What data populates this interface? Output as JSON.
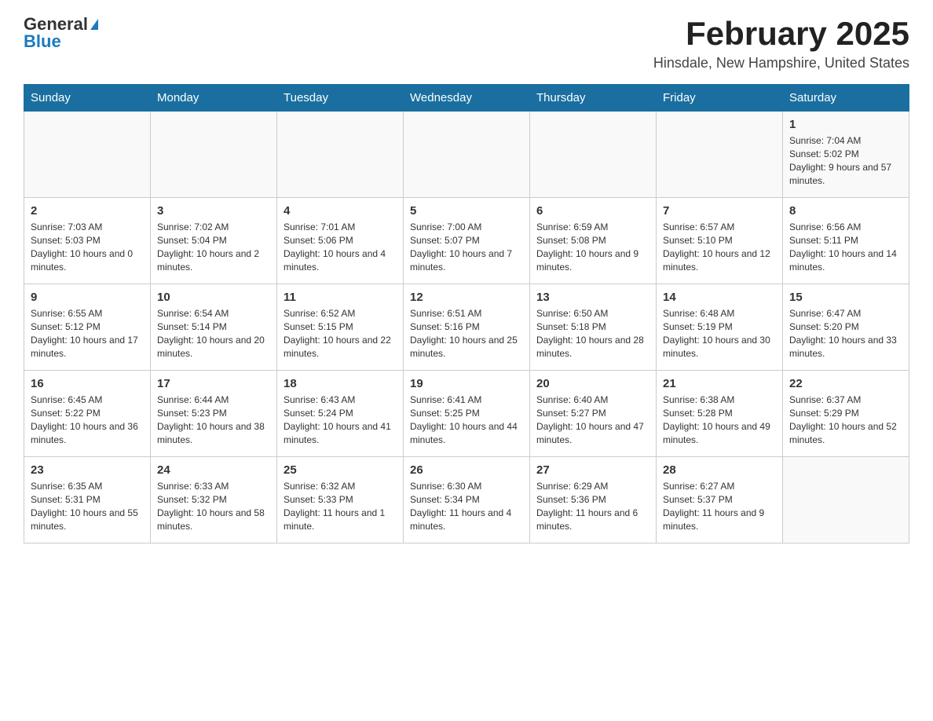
{
  "logo": {
    "text_general": "General",
    "text_blue": "Blue",
    "arrow_label": "general-blue-arrow"
  },
  "title": {
    "month": "February 2025",
    "location": "Hinsdale, New Hampshire, United States"
  },
  "days_of_week": [
    "Sunday",
    "Monday",
    "Tuesday",
    "Wednesday",
    "Thursday",
    "Friday",
    "Saturday"
  ],
  "weeks": [
    [
      {
        "date": "",
        "info": ""
      },
      {
        "date": "",
        "info": ""
      },
      {
        "date": "",
        "info": ""
      },
      {
        "date": "",
        "info": ""
      },
      {
        "date": "",
        "info": ""
      },
      {
        "date": "",
        "info": ""
      },
      {
        "date": "1",
        "info": "Sunrise: 7:04 AM\nSunset: 5:02 PM\nDaylight: 9 hours and 57 minutes."
      }
    ],
    [
      {
        "date": "2",
        "info": "Sunrise: 7:03 AM\nSunset: 5:03 PM\nDaylight: 10 hours and 0 minutes."
      },
      {
        "date": "3",
        "info": "Sunrise: 7:02 AM\nSunset: 5:04 PM\nDaylight: 10 hours and 2 minutes."
      },
      {
        "date": "4",
        "info": "Sunrise: 7:01 AM\nSunset: 5:06 PM\nDaylight: 10 hours and 4 minutes."
      },
      {
        "date": "5",
        "info": "Sunrise: 7:00 AM\nSunset: 5:07 PM\nDaylight: 10 hours and 7 minutes."
      },
      {
        "date": "6",
        "info": "Sunrise: 6:59 AM\nSunset: 5:08 PM\nDaylight: 10 hours and 9 minutes."
      },
      {
        "date": "7",
        "info": "Sunrise: 6:57 AM\nSunset: 5:10 PM\nDaylight: 10 hours and 12 minutes."
      },
      {
        "date": "8",
        "info": "Sunrise: 6:56 AM\nSunset: 5:11 PM\nDaylight: 10 hours and 14 minutes."
      }
    ],
    [
      {
        "date": "9",
        "info": "Sunrise: 6:55 AM\nSunset: 5:12 PM\nDaylight: 10 hours and 17 minutes."
      },
      {
        "date": "10",
        "info": "Sunrise: 6:54 AM\nSunset: 5:14 PM\nDaylight: 10 hours and 20 minutes."
      },
      {
        "date": "11",
        "info": "Sunrise: 6:52 AM\nSunset: 5:15 PM\nDaylight: 10 hours and 22 minutes."
      },
      {
        "date": "12",
        "info": "Sunrise: 6:51 AM\nSunset: 5:16 PM\nDaylight: 10 hours and 25 minutes."
      },
      {
        "date": "13",
        "info": "Sunrise: 6:50 AM\nSunset: 5:18 PM\nDaylight: 10 hours and 28 minutes."
      },
      {
        "date": "14",
        "info": "Sunrise: 6:48 AM\nSunset: 5:19 PM\nDaylight: 10 hours and 30 minutes."
      },
      {
        "date": "15",
        "info": "Sunrise: 6:47 AM\nSunset: 5:20 PM\nDaylight: 10 hours and 33 minutes."
      }
    ],
    [
      {
        "date": "16",
        "info": "Sunrise: 6:45 AM\nSunset: 5:22 PM\nDaylight: 10 hours and 36 minutes."
      },
      {
        "date": "17",
        "info": "Sunrise: 6:44 AM\nSunset: 5:23 PM\nDaylight: 10 hours and 38 minutes."
      },
      {
        "date": "18",
        "info": "Sunrise: 6:43 AM\nSunset: 5:24 PM\nDaylight: 10 hours and 41 minutes."
      },
      {
        "date": "19",
        "info": "Sunrise: 6:41 AM\nSunset: 5:25 PM\nDaylight: 10 hours and 44 minutes."
      },
      {
        "date": "20",
        "info": "Sunrise: 6:40 AM\nSunset: 5:27 PM\nDaylight: 10 hours and 47 minutes."
      },
      {
        "date": "21",
        "info": "Sunrise: 6:38 AM\nSunset: 5:28 PM\nDaylight: 10 hours and 49 minutes."
      },
      {
        "date": "22",
        "info": "Sunrise: 6:37 AM\nSunset: 5:29 PM\nDaylight: 10 hours and 52 minutes."
      }
    ],
    [
      {
        "date": "23",
        "info": "Sunrise: 6:35 AM\nSunset: 5:31 PM\nDaylight: 10 hours and 55 minutes."
      },
      {
        "date": "24",
        "info": "Sunrise: 6:33 AM\nSunset: 5:32 PM\nDaylight: 10 hours and 58 minutes."
      },
      {
        "date": "25",
        "info": "Sunrise: 6:32 AM\nSunset: 5:33 PM\nDaylight: 11 hours and 1 minute."
      },
      {
        "date": "26",
        "info": "Sunrise: 6:30 AM\nSunset: 5:34 PM\nDaylight: 11 hours and 4 minutes."
      },
      {
        "date": "27",
        "info": "Sunrise: 6:29 AM\nSunset: 5:36 PM\nDaylight: 11 hours and 6 minutes."
      },
      {
        "date": "28",
        "info": "Sunrise: 6:27 AM\nSunset: 5:37 PM\nDaylight: 11 hours and 9 minutes."
      },
      {
        "date": "",
        "info": ""
      }
    ]
  ]
}
